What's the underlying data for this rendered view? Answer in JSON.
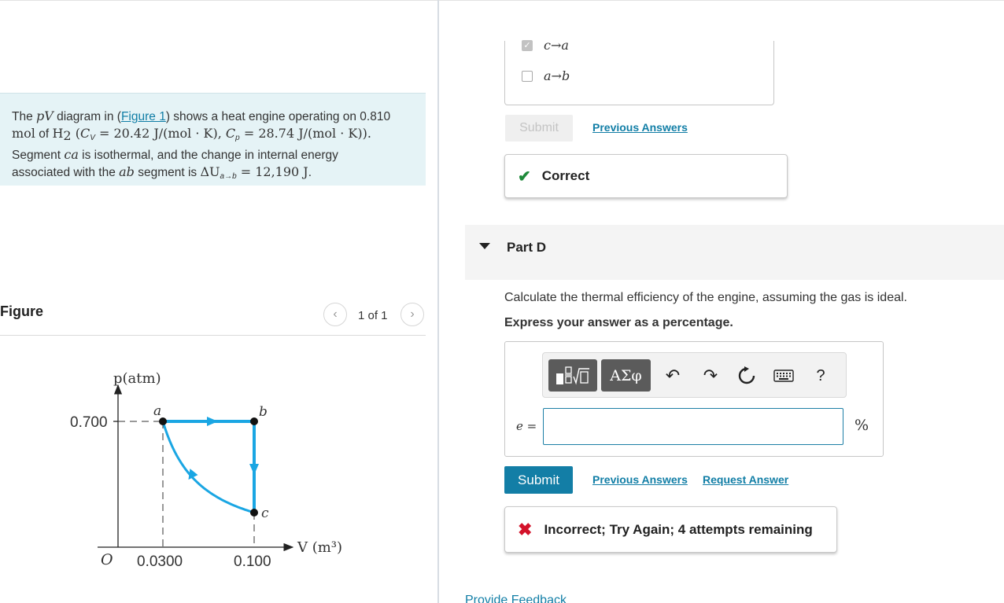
{
  "problem": {
    "t1": "The ",
    "pV": "pV",
    "t2": " diagram in (",
    "figure_link": "Figure 1",
    "t3": ") shows a heat engine operating on 0.810",
    "l2_mol": "mol",
    "l2_of": " of ",
    "h2": "H",
    "h2_sub": "2",
    "l2_cv_open": " (",
    "cv": "C",
    "cv_sub": "V",
    "cv_rest": " = 20.42 J/(mol · K), ",
    "cp": "C",
    "cp_sub": "p",
    "cp_rest": " = 28.74 J/(mol · K)).",
    "l3a": "Segment ",
    "ca": "ca",
    "l3b": " is isothermal, and the change in internal energy",
    "l4a": "associated with the ",
    "ab": "ab",
    "l4b": " segment is ",
    "du": "ΔU",
    "du_sub": "a→b",
    "du_val": " = 12,190 J",
    "period": "."
  },
  "figure": {
    "title": "Figure",
    "pager": "1 of 1",
    "prev_icon": "chevron-left-icon",
    "next_icon": "chevron-right-icon"
  },
  "chart_data": {
    "type": "line",
    "title": "",
    "xlabel": "V (m³)",
    "ylabel": "p(atm)",
    "origin_label": "O",
    "x_ticks": [
      "0.0300",
      "0.100"
    ],
    "y_ticks": [
      "0.700"
    ],
    "points": [
      {
        "label": "a",
        "V": 0.03,
        "p": 0.7
      },
      {
        "label": "b",
        "V": 0.1,
        "p": 0.7
      },
      {
        "label": "c",
        "V": 0.1,
        "p": 0.21
      }
    ],
    "segments": [
      "a→b",
      "b→c",
      "c→a"
    ],
    "line_color": "#1aa6e3"
  },
  "choices": [
    {
      "label": "c→a",
      "checked": true
    },
    {
      "label": "a→b",
      "checked": false
    }
  ],
  "partC": {
    "submit_label": "Submit",
    "previous_answers": "Previous Answers",
    "feedback": "Correct"
  },
  "partD": {
    "label": "Part D",
    "question": "Calculate the thermal efficiency of the engine, assuming the gas is ideal.",
    "instruction": "Express your answer as a percentage.",
    "toolbar": {
      "templates_icon": "fraction-sqrt-template-icon",
      "greek": "ΑΣφ",
      "undo_icon": "undo-icon",
      "redo_icon": "redo-icon",
      "reset_icon": "reset-icon",
      "keyboard_icon": "keyboard-icon",
      "help": "?"
    },
    "var_label": "e =",
    "input_value": "",
    "unit": "%",
    "submit_label": "Submit",
    "previous_answers": "Previous Answers",
    "request_answer": "Request Answer",
    "feedback": "Incorrect; Try Again; 4 attempts remaining"
  },
  "footer": {
    "provide_feedback": "Provide Feedback"
  },
  "colors": {
    "accent": "#137ea6",
    "correct": "#1e8a3a",
    "incorrect": "#d3122a",
    "problem_bg": "#e5f3f6"
  }
}
